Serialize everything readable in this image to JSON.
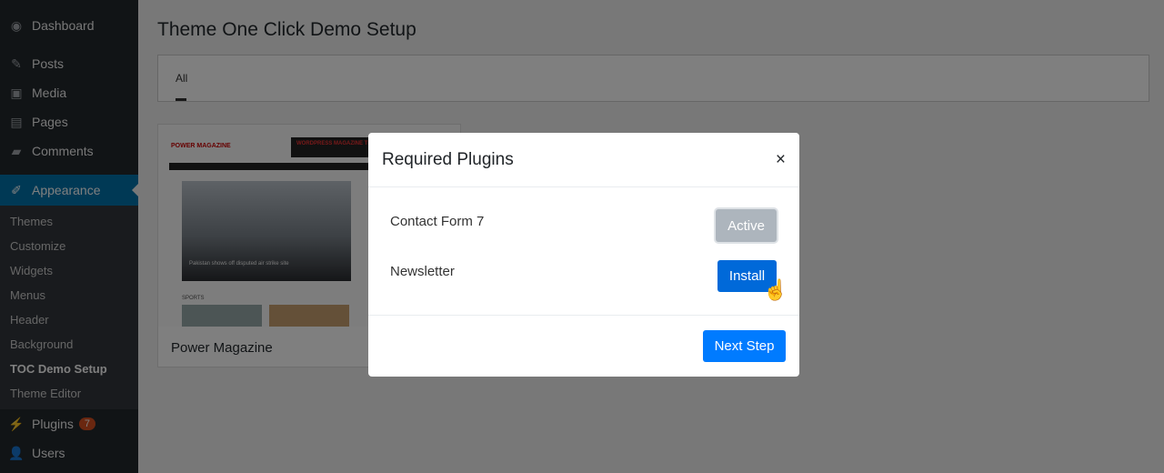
{
  "sidebar": {
    "items": [
      {
        "label": "Dashboard",
        "icon": "dashboard-icon"
      },
      {
        "label": "Posts",
        "icon": "pin-icon"
      },
      {
        "label": "Media",
        "icon": "media-icon"
      },
      {
        "label": "Pages",
        "icon": "pages-icon"
      },
      {
        "label": "Comments",
        "icon": "comment-icon"
      },
      {
        "label": "Appearance",
        "icon": "brush-icon"
      }
    ],
    "submenu": [
      "Themes",
      "Customize",
      "Widgets",
      "Menus",
      "Header",
      "Background",
      "TOC Demo Setup",
      "Theme Editor"
    ],
    "plugins": {
      "label": "Plugins",
      "badge": "7"
    },
    "users": {
      "label": "Users"
    }
  },
  "page": {
    "title": "Theme One Click Demo Setup",
    "filter_tab": "All"
  },
  "theme_card": {
    "name": "Power Magazine",
    "thumb_logo": "POWER MAGAZINE",
    "thumb_banner": "WORDPRESS MAGAZINE THEME",
    "thumb_headline": "Pakistan shows off disputed air strike site",
    "thumb_section": "SPORTS"
  },
  "modal": {
    "title": "Required Plugins",
    "close": "×",
    "plugins": [
      {
        "name": "Contact Form 7",
        "action": "Active"
      },
      {
        "name": "Newsletter",
        "action": "Install"
      }
    ],
    "next": "Next Step"
  },
  "colors": {
    "accent": "#0073aa",
    "install": "#0069d9",
    "next": "#007bff",
    "active_btn": "#adb5bd"
  }
}
